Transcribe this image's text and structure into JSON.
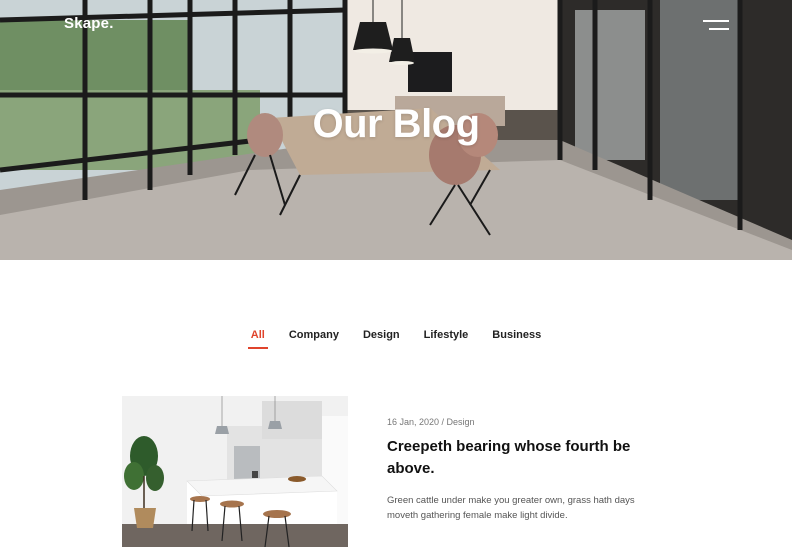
{
  "header": {
    "logo": "Skape.",
    "menu_icon": "hamburger-menu-icon"
  },
  "hero": {
    "title": "Our Blog"
  },
  "filters": [
    {
      "label": "All",
      "active": true
    },
    {
      "label": "Company",
      "active": false
    },
    {
      "label": "Design",
      "active": false
    },
    {
      "label": "Lifestyle",
      "active": false
    },
    {
      "label": "Business",
      "active": false
    }
  ],
  "posts": [
    {
      "meta": "16 Jan, 2020 / Design",
      "title": "Creepeth bearing whose fourth be above.",
      "excerpt": "Green cattle under make you greater own, grass hath days moveth gathering female make light divide."
    }
  ],
  "colors": {
    "accent": "#e0442c",
    "text": "#111111",
    "muted": "#777777"
  }
}
